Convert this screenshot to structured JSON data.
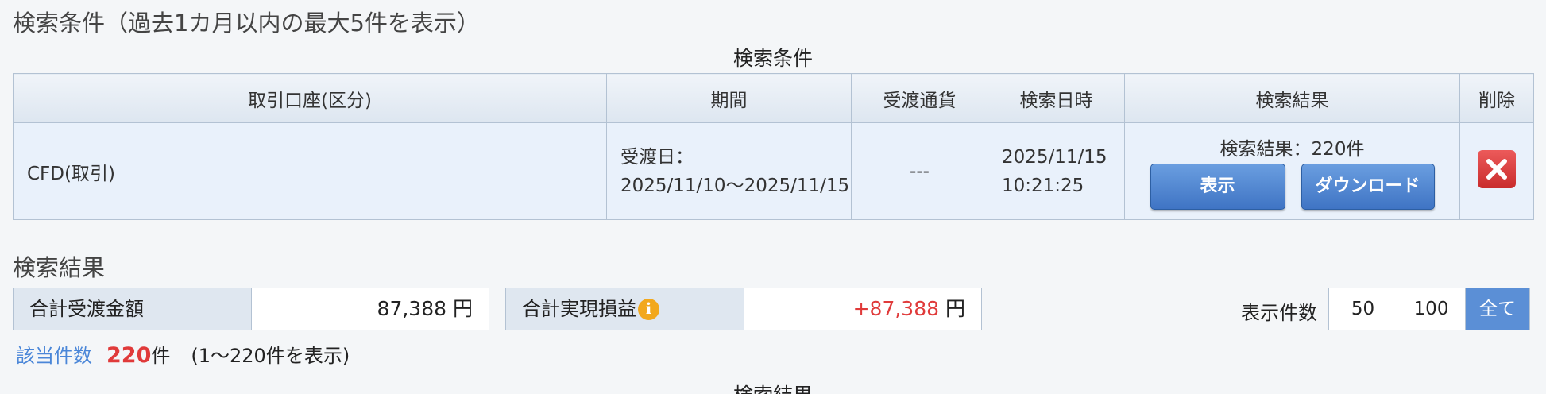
{
  "search_conditions": {
    "title": "検索条件（過去1カ月以内の最大5件を表示）",
    "caption": "検索条件",
    "headers": [
      "取引口座(区分)",
      "期間",
      "受渡通貨",
      "検索日時",
      "検索結果",
      "削除"
    ],
    "row": {
      "account": "CFD(取引)",
      "period_label": "受渡日：",
      "period_range": "2025/11/10〜2025/11/15",
      "currency": "---",
      "search_date": "2025/11/15",
      "search_time": "10:21:25",
      "result_text": "検索結果：220件",
      "show_button": "表示",
      "download_button": "ダウンロード"
    }
  },
  "search_results": {
    "title": "検索結果",
    "caption": "検索結果",
    "total_settlement_label": "合計受渡金額",
    "total_settlement_value": "87,388",
    "total_settlement_unit": "円",
    "total_pl_label": "合計実現損益",
    "total_pl_value": "+87,388",
    "total_pl_unit": "円",
    "display_count_label": "表示件数",
    "display_options": [
      "50",
      "100",
      "全て"
    ],
    "hit_label": "該当件数",
    "hit_count": "220",
    "hit_unit": "件",
    "hit_range": "(1〜220件を表示)"
  },
  "colors": {
    "accent_blue": "#4a86d8",
    "profit_red": "#e03a3a",
    "delete_red": "#d93a3a",
    "info_orange": "#f2a81d"
  }
}
